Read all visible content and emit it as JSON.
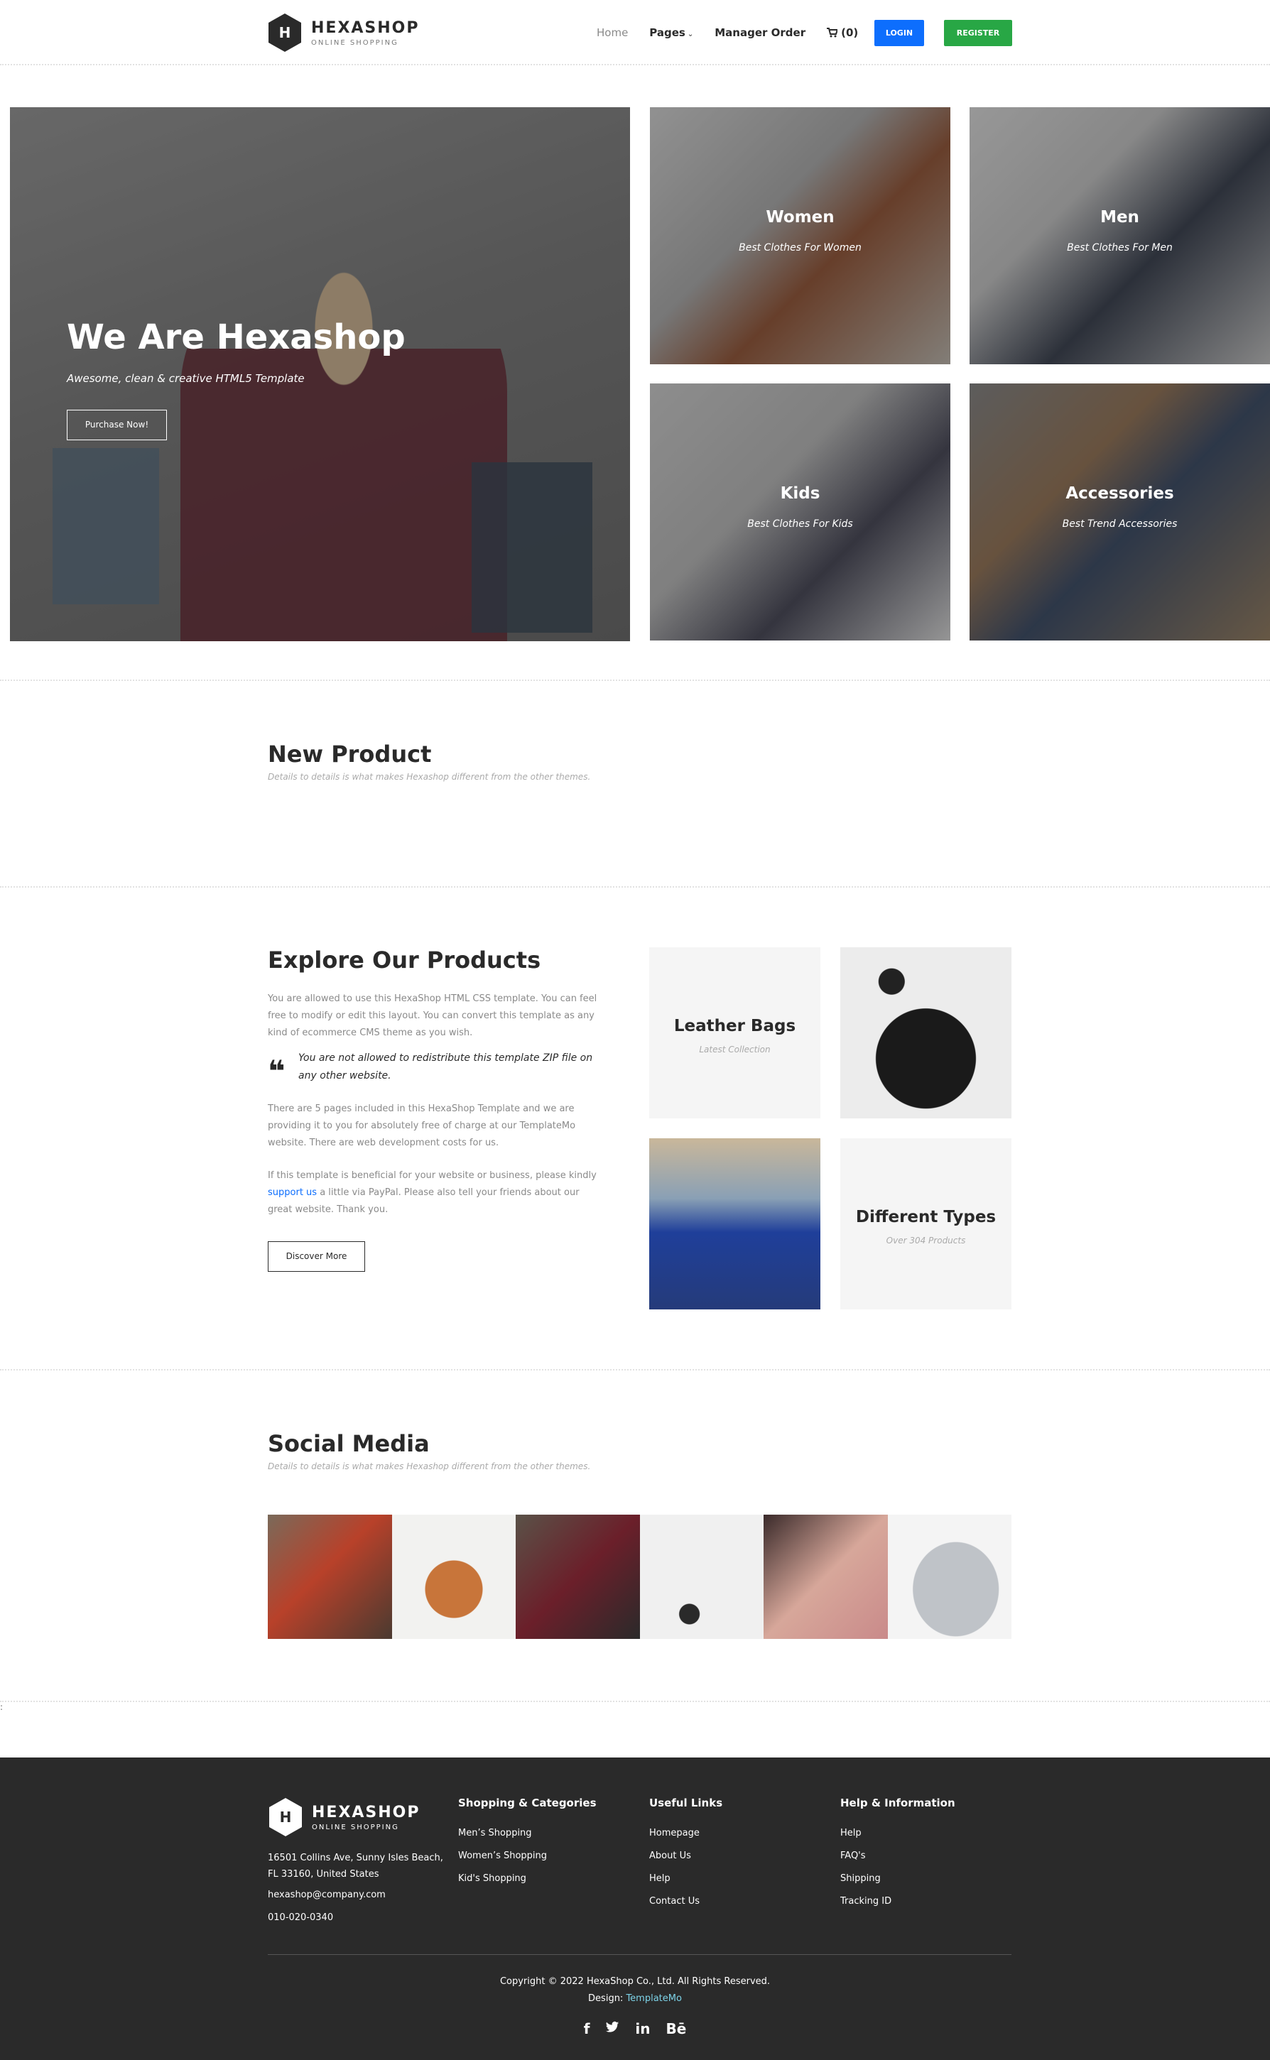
{
  "header": {
    "brand": "HEXASHOP",
    "brand_sub": "ONLINE SHOPPING",
    "logo_letter": "H",
    "nav": {
      "home": "Home",
      "pages": "Pages",
      "manager_order": "Manager Order",
      "cart": "(0)"
    },
    "login": "LOGIN",
    "register": "REGISTER"
  },
  "hero": {
    "title": "We Are Hexashop",
    "subtitle": "Awesome, clean & creative HTML5 Template",
    "button": "Purchase Now!",
    "categories": [
      {
        "title": "Women",
        "subtitle": "Best Clothes For Women"
      },
      {
        "title": "Men",
        "subtitle": "Best Clothes For Men"
      },
      {
        "title": "Kids",
        "subtitle": "Best Clothes For Kids"
      },
      {
        "title": "Accessories",
        "subtitle": "Best Trend Accessories"
      }
    ]
  },
  "new_product": {
    "title": "New Product",
    "subtitle": "Details to details is what makes Hexashop different from the other themes."
  },
  "explore": {
    "title": "Explore Our Products",
    "p1": "You are allowed to use this HexaShop HTML CSS template. You can feel free to modify or edit this layout. You can convert this template as any kind of ecommerce CMS theme as you wish.",
    "quote": "You are not allowed to redistribute this template ZIP file on any other website.",
    "p2": "There are 5 pages included in this HexaShop Template and we are providing it to you for absolutely free of charge at our TemplateMo website. There are web development costs for us.",
    "p3_before": "If this template is beneficial for your website or business, please kindly ",
    "p3_link": "support us",
    "p3_after": " a little via PayPal. Please also tell your friends about our great website. Thank you.",
    "button": "Discover More",
    "box1_title": "Leather Bags",
    "box1_sub": "Latest Collection",
    "box2_title": "Different Types",
    "box2_sub": "Over 304 Products"
  },
  "social": {
    "title": "Social Media",
    "subtitle": "Details to details is what makes Hexashop different from the other themes."
  },
  "footer": {
    "brand": "HEXASHOP",
    "brand_sub": "ONLINE SHOPPING",
    "logo_letter": "H",
    "address": "16501 Collins Ave, Sunny Isles Beach, FL 33160, United States",
    "email": "hexashop@company.com",
    "phone": "010-020-0340",
    "col1": {
      "title": "Shopping & Categories",
      "links": [
        "Men’s Shopping",
        "Women’s Shopping",
        "Kid's Shopping"
      ]
    },
    "col2": {
      "title": "Useful Links",
      "links": [
        "Homepage",
        "About Us",
        "Help",
        "Contact Us"
      ]
    },
    "col3": {
      "title": "Help & Information",
      "links": [
        "Help",
        "FAQ's",
        "Shipping",
        "Tracking ID"
      ]
    },
    "copyright": "Copyright © 2022 HexaShop Co., Ltd. All Rights Reserved.",
    "design_label": "Design: ",
    "design_link": "TemplateMo",
    "social": {
      "facebook": "f",
      "twitter": "🐦",
      "linkedin": "in",
      "behance": "Bē"
    }
  },
  "icons": {
    "cart": "shopping-cart-icon",
    "chevron": "chevron-down-icon",
    "quote": "quote-icon"
  },
  "colors": {
    "login": "#0d6efd",
    "register": "#28a745",
    "footer_bg": "#2a2a2a",
    "design_link": "#7dd3e8"
  }
}
